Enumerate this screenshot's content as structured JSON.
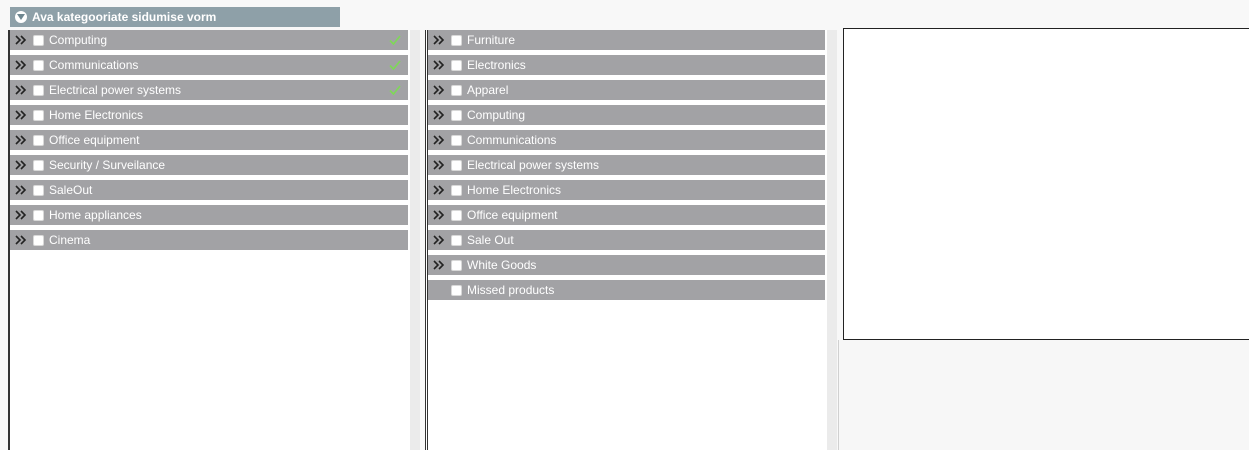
{
  "header": {
    "title": "Ava kategooriate sidumise vorm",
    "icon": "chevron-down-circle-icon"
  },
  "colors": {
    "header_bg": "#8ea0a8",
    "row_bg": "#a2a2a5",
    "check_green": "#7ed957"
  },
  "left_panel": {
    "items": [
      {
        "label": "Computing",
        "linked": true
      },
      {
        "label": "Communications",
        "linked": true
      },
      {
        "label": "Electrical power systems",
        "linked": true
      },
      {
        "label": "Home Electronics",
        "linked": false
      },
      {
        "label": "Office equipment",
        "linked": false
      },
      {
        "label": "Security / Surveilance",
        "linked": false
      },
      {
        "label": "SaleOut",
        "linked": false
      },
      {
        "label": "Home appliances",
        "linked": false
      },
      {
        "label": "Cinema",
        "linked": false
      }
    ]
  },
  "middle_panel": {
    "items": [
      {
        "label": "Furniture",
        "expandable": true
      },
      {
        "label": "Electronics",
        "expandable": true
      },
      {
        "label": "Apparel",
        "expandable": true
      },
      {
        "label": "Computing",
        "expandable": true
      },
      {
        "label": "Communications",
        "expandable": true
      },
      {
        "label": "Electrical power systems",
        "expandable": true
      },
      {
        "label": "Home Electronics",
        "expandable": true
      },
      {
        "label": "Office equipment",
        "expandable": true
      },
      {
        "label": "Sale Out",
        "expandable": true
      },
      {
        "label": "White Goods",
        "expandable": true
      },
      {
        "label": "Missed products",
        "expandable": false
      }
    ]
  }
}
